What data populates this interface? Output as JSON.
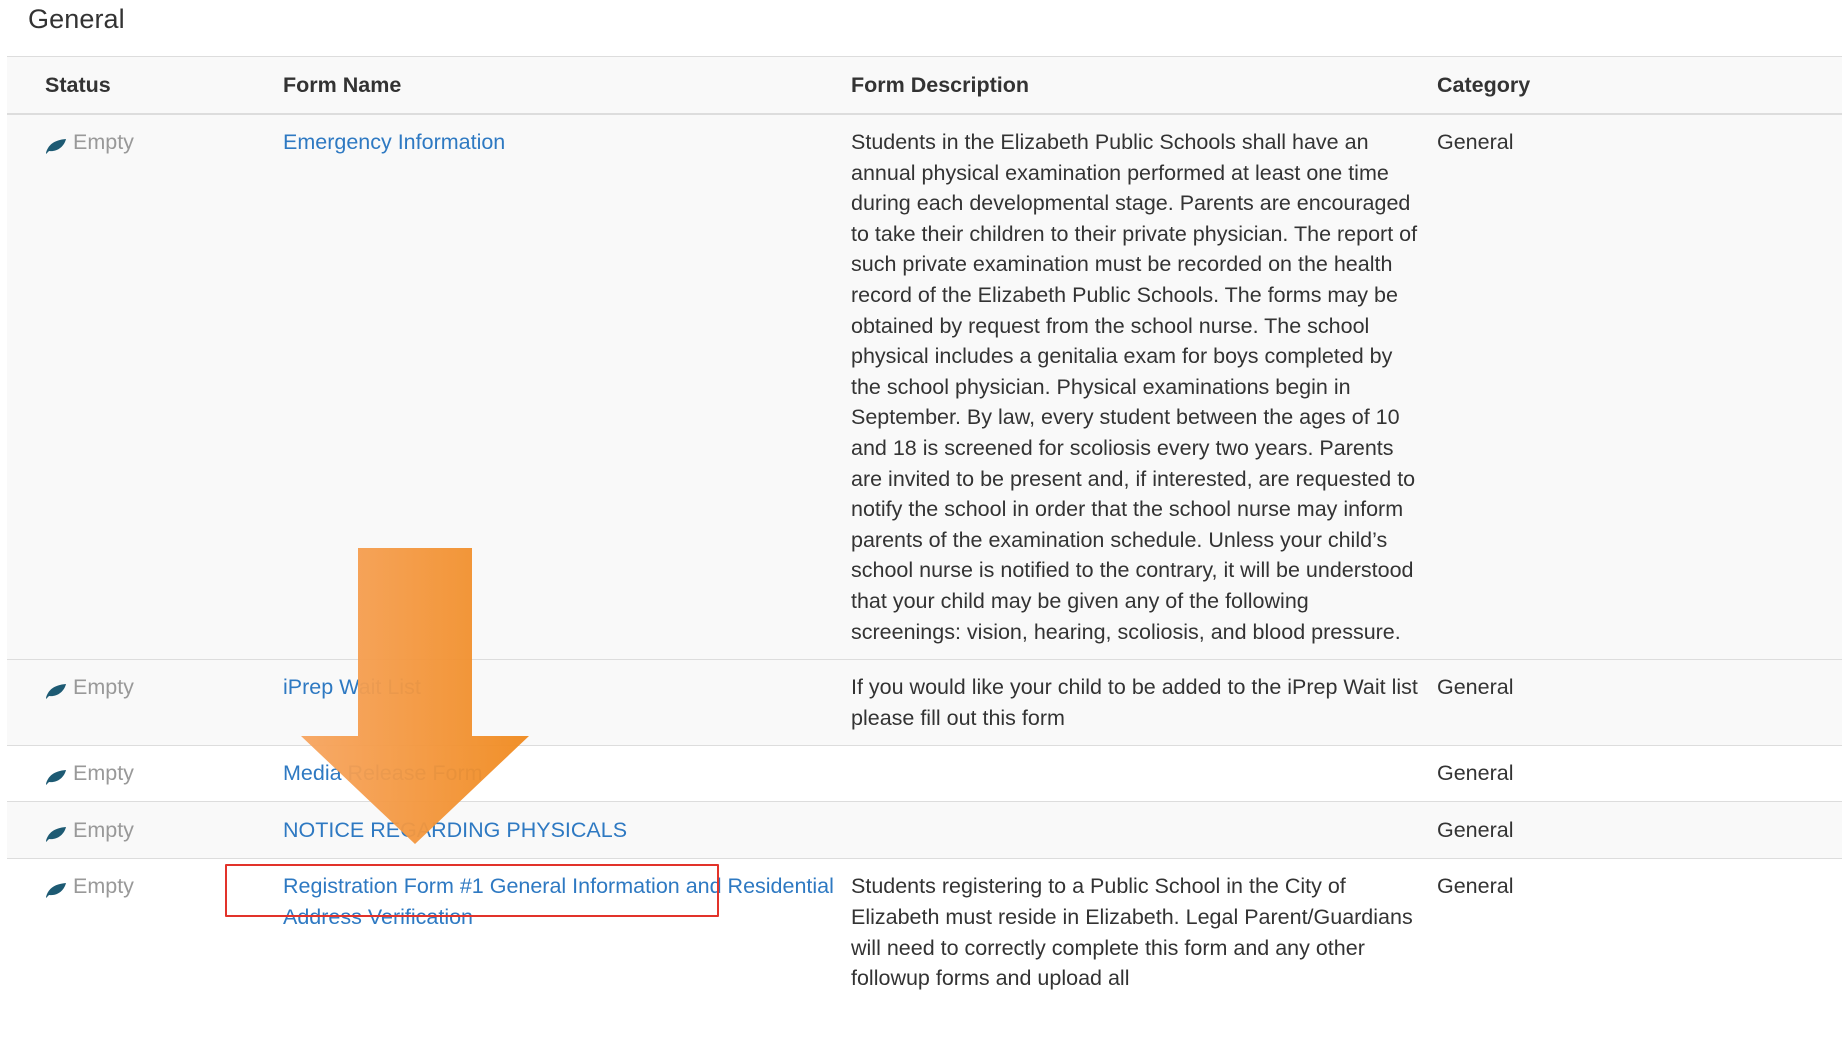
{
  "section": {
    "title": "General"
  },
  "table": {
    "headers": {
      "status": "Status",
      "name": "Form Name",
      "description": "Form Description",
      "category": "Category"
    },
    "rows": [
      {
        "status": "Empty",
        "name": "Emergency Information",
        "description": "Students in the Elizabeth Public Schools shall have an annual physical examination performed at least one time during each developmental stage. Parents are encouraged to take their children to their private physician. The report of such private examination must be recorded on the health record of the Elizabeth Public Schools. The forms may be obtained by request from the school nurse. The school physical includes a genitalia exam for boys completed by the school physician. Physical examinations begin in September. By law, every student between the ages of 10 and 18 is screened for scoliosis every two years. Parents are invited to be present and, if interested, are requested to notify the school in order that the school nurse may inform parents of the examination schedule. Unless your child’s school nurse is notified to the contrary, it will be understood that your child may be given any of the following screenings: vision, hearing, scoliosis, and blood pressure.",
        "category": "General"
      },
      {
        "status": "Empty",
        "name": "iPrep Wait List",
        "description": "If you would like your child to be added to the iPrep Wait list please fill out this form",
        "category": "General"
      },
      {
        "status": "Empty",
        "name": "Media Release Form",
        "description": "",
        "category": "General"
      },
      {
        "status": "Empty",
        "name": "NOTICE REGARDING PHYSICALS",
        "description": "",
        "category": "General"
      },
      {
        "status": "Empty",
        "name": "Registration Form #1 General Information and Residential Address Verification",
        "description": "Students registering to a Public School in the City of Elizabeth must reside in Elizabeth. Legal Parent/Guardians will need to correctly complete this form and any other followup forms and upload all",
        "category": "General"
      }
    ]
  },
  "annotation": {
    "arrow_color": "#f38a25",
    "box_color": "#e2332a",
    "highlighted_form": "NOTICE REGARDING PHYSICALS"
  },
  "icons": {
    "status": "leaf-icon",
    "status_color": "#1d5a73"
  }
}
